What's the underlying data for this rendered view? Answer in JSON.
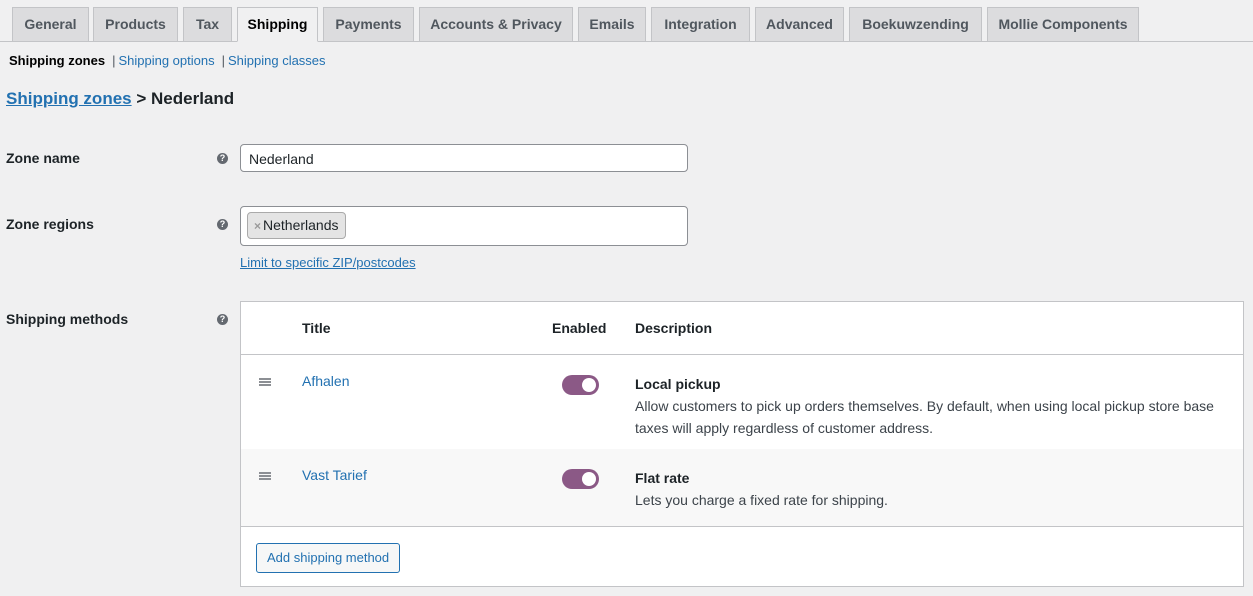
{
  "tabs": [
    "General",
    "Products",
    "Tax",
    "Shipping",
    "Payments",
    "Accounts & Privacy",
    "Emails",
    "Integration",
    "Advanced",
    "Boekuwzending",
    "Mollie Components"
  ],
  "active_tab": "Shipping",
  "subnav": {
    "current": "Shipping zones",
    "links": [
      "Shipping options",
      "Shipping classes"
    ],
    "separator": "|"
  },
  "breadcrumb": {
    "link": "Shipping zones",
    "sep": ">",
    "current": "Nederland"
  },
  "zone_name": {
    "label": "Zone name",
    "value": "Nederland"
  },
  "zone_regions": {
    "label": "Zone regions",
    "chip": "Netherlands",
    "chip_remove": "×",
    "limit_link": "Limit to specific ZIP/postcodes"
  },
  "help_icon": "?",
  "shipping_methods": {
    "label": "Shipping methods",
    "headers": {
      "title": "Title",
      "enabled": "Enabled",
      "description": "Description"
    },
    "rows": [
      {
        "title": "Afhalen",
        "enabled": true,
        "type": "Local pickup",
        "text": "Allow customers to pick up orders themselves. By default, when using local pickup store base taxes will apply regardless of customer address."
      },
      {
        "title": "Vast Tarief",
        "enabled": true,
        "type": "Flat rate",
        "text": "Lets you charge a fixed rate for shipping."
      }
    ],
    "add_button": "Add shipping method"
  },
  "colors": {
    "link": "#2271b1",
    "toggle_on": "#8b5986"
  }
}
